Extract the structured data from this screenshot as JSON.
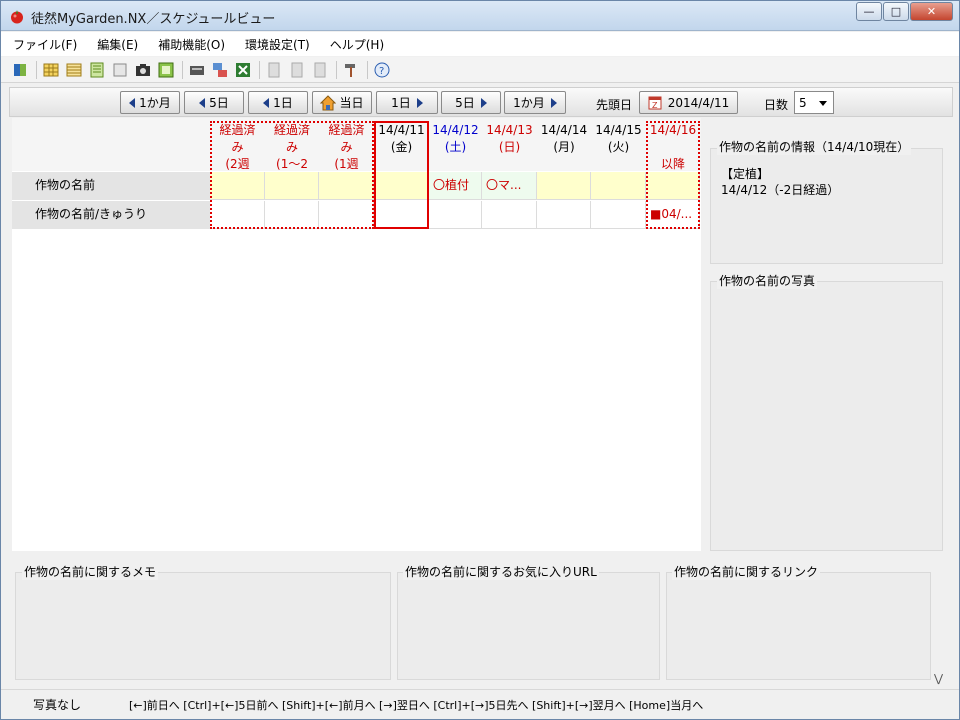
{
  "window": {
    "title": "徒然MyGarden.NX／スケジュールビュー",
    "controls": [
      "minimize-icon",
      "maximize-icon",
      "close-icon"
    ]
  },
  "menu": [
    "ファイル(F)",
    "編集(E)",
    "補助機能(O)",
    "環境設定(T)",
    "ヘルプ(H)"
  ],
  "toolbar_icons": [
    "book-icon",
    "grid-icon",
    "table-icon",
    "list-icon",
    "note-icon",
    "camera-icon",
    "green-grid-icon",
    "card-icon",
    "network-icon",
    "excel-icon",
    "doc-disabled-icon",
    "doc2-disabled-icon",
    "doc3-disabled-icon",
    "hammer-icon",
    "help-icon"
  ],
  "nav": {
    "prev_month": "1か月",
    "prev_5": "5日",
    "prev_1": "1日",
    "today": "当日",
    "next_1": "1日",
    "next_5": "5日",
    "next_month": "1か月",
    "start_label": "先頭日",
    "start_value": "2014/4/11",
    "days_label": "日数",
    "days_value": "5"
  },
  "columns": [
    {
      "line1": "経過済",
      "line2": "み",
      "line3": "(2週",
      "color": "#cc0000"
    },
    {
      "line1": "経過済",
      "line2": "み",
      "line3": "(1～2",
      "color": "#cc0000"
    },
    {
      "line1": "経過済",
      "line2": "み",
      "line3": "(1週",
      "color": "#cc0000"
    },
    {
      "line1": "14/4/11",
      "line2": "(金)",
      "line3": "",
      "color": "#000000"
    },
    {
      "line1": "14/4/12",
      "line2": "(土)",
      "line3": "",
      "color": "#0000cc"
    },
    {
      "line1": "14/4/13",
      "line2": "(日)",
      "line3": "",
      "color": "#cc0000"
    },
    {
      "line1": "14/4/14",
      "line2": "(月)",
      "line3": "",
      "color": "#000000"
    },
    {
      "line1": "14/4/15",
      "line2": "(火)",
      "line3": "",
      "color": "#000000"
    },
    {
      "line1": "14/4/16",
      "line2": "",
      "line3": "以降",
      "color": "#cc0000"
    }
  ],
  "rows": [
    {
      "label": "作物の名前",
      "cells": [
        "",
        "",
        "",
        "",
        "〇植付",
        "〇マ...",
        "",
        "",
        ""
      ]
    },
    {
      "label": "作物の名前/きゅうり",
      "cells": [
        "",
        "",
        "",
        "",
        "",
        "",
        "",
        "",
        "■04/..."
      ]
    }
  ],
  "info_panel": {
    "title": "作物の名前の情報（14/4/10現在）",
    "line1": "【定植】",
    "line2": "14/4/12（-2日経過）"
  },
  "photo_panel": {
    "title": "作物の名前の写真"
  },
  "memo_panel": {
    "title": "作物の名前に関するメモ"
  },
  "url_panel": {
    "title": "作物の名前に関するお気に入りURL"
  },
  "link_panel": {
    "title": "作物の名前に関するリンク"
  },
  "status": {
    "photo": "写真なし",
    "shortcuts": "[←]前日へ [Ctrl]+[←]5日前へ [Shift]+[←]前月へ [→]翌日へ [Ctrl]+[→]5日先へ [Shift]+[→]翌月へ [Home]当月へ"
  }
}
